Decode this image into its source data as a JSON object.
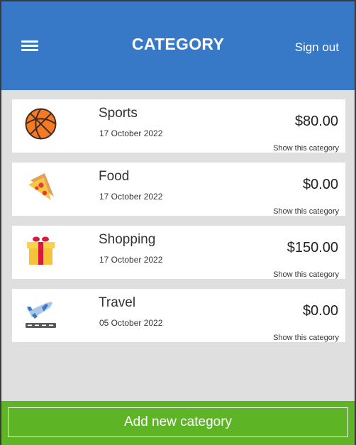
{
  "header": {
    "title": "CATEGORY",
    "sign_out": "Sign out",
    "color": "#3779c6"
  },
  "categories": [
    {
      "name": "Sports",
      "date": "17 October 2022",
      "amount": "$80.00",
      "link": "Show this category",
      "icon": "basketball-icon"
    },
    {
      "name": "Food",
      "date": "17 October 2022",
      "amount": "$0.00",
      "link": "Show this category",
      "icon": "pizza-icon"
    },
    {
      "name": "Shopping",
      "date": "17 October 2022",
      "amount": "$150.00",
      "link": "Show this category",
      "icon": "gift-icon"
    },
    {
      "name": "Travel",
      "date": "05 October 2022",
      "amount": "$0.00",
      "link": "Show this category",
      "icon": "airplane-icon"
    }
  ],
  "footer": {
    "add_label": "Add new category",
    "color": "#5db526"
  }
}
